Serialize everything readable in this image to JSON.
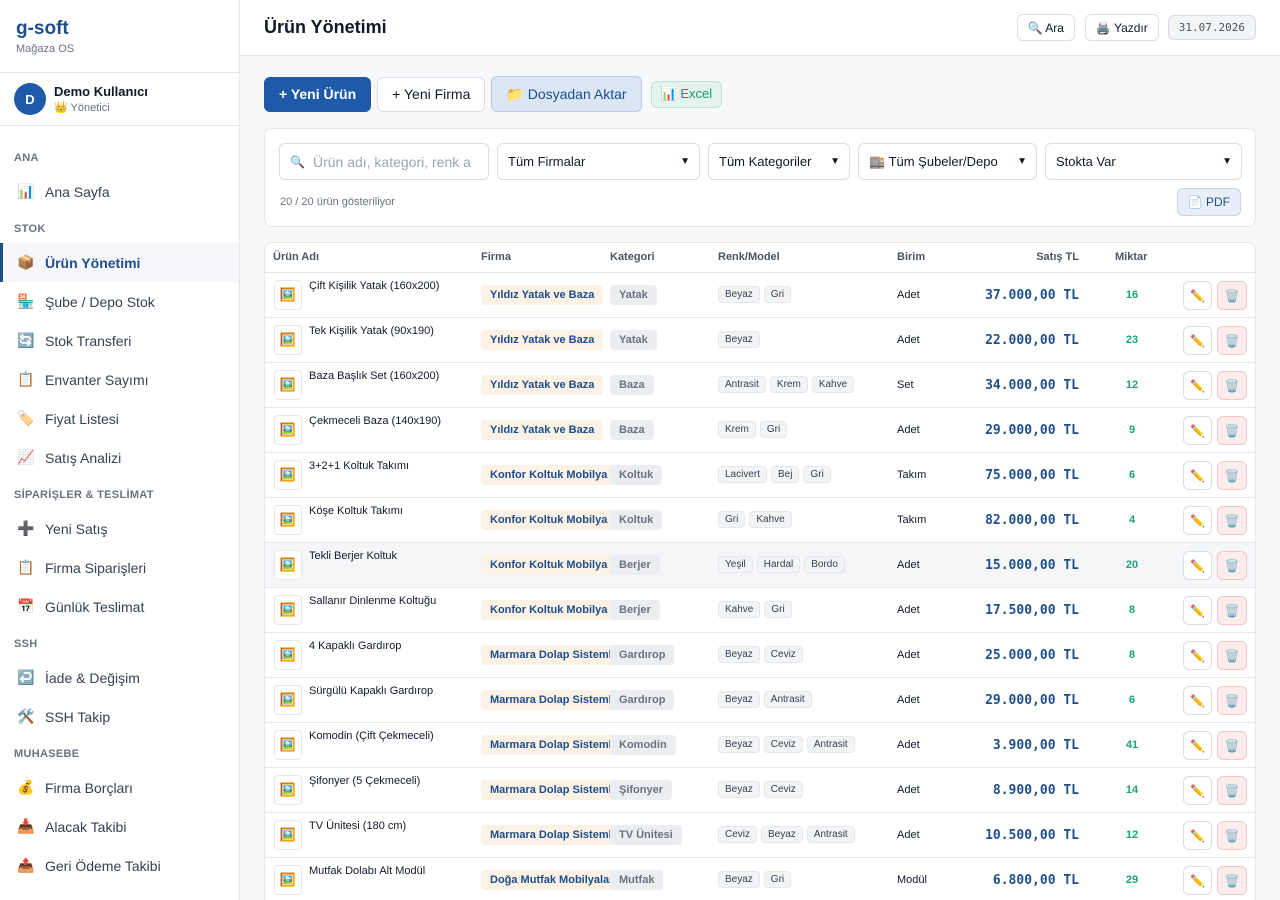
{
  "brand": {
    "name": "g-soft",
    "subtitle": "Mağaza OS"
  },
  "user": {
    "initial": "D",
    "name": "Demo Kullanıcı",
    "role": "👑 Yönetici"
  },
  "nav": [
    {
      "section": "ANA",
      "items": [
        {
          "icon": "📊",
          "label": "Ana Sayfa"
        }
      ]
    },
    {
      "section": "STOK",
      "items": [
        {
          "icon": "📦",
          "label": "Ürün Yönetimi",
          "active": true
        },
        {
          "icon": "🏪",
          "label": "Şube / Depo Stok"
        },
        {
          "icon": "🔄",
          "label": "Stok Transferi"
        },
        {
          "icon": "📋",
          "label": "Envanter Sayımı"
        },
        {
          "icon": "🏷️",
          "label": "Fiyat Listesi"
        },
        {
          "icon": "📈",
          "label": "Satış Analizi"
        }
      ]
    },
    {
      "section": "SİPARİŞLER & TESLİMAT",
      "items": [
        {
          "icon": "➕",
          "label": "Yeni Satış"
        },
        {
          "icon": "📋",
          "label": "Firma Siparişleri"
        },
        {
          "icon": "📅",
          "label": "Günlük Teslimat"
        }
      ]
    },
    {
      "section": "SSH",
      "items": [
        {
          "icon": "↩️",
          "label": "İade & Değişim"
        },
        {
          "icon": "🛠️",
          "label": "SSH Takip"
        }
      ]
    },
    {
      "section": "MUHASEBE",
      "items": [
        {
          "icon": "💰",
          "label": "Firma Borçları"
        },
        {
          "icon": "📥",
          "label": "Alacak Takibi"
        },
        {
          "icon": "📤",
          "label": "Geri Ödeme Takibi"
        }
      ]
    }
  ],
  "header": {
    "title": "Ürün Yönetimi",
    "search_label": "🔍 Ara",
    "print_label": "🖨️ Yazdır",
    "date": "31.07.2026"
  },
  "actions": {
    "new_product": "+ Yeni Ürün",
    "new_firm": "+ Yeni Firma",
    "import": "📁 Dosyadan Aktar",
    "excel": "📊 Excel"
  },
  "filters": {
    "search_placeholder": "Ürün adı, kategori, renk a",
    "firm": "Tüm Firmalar",
    "category": "Tüm Kategoriler",
    "branch": "🏬 Tüm Şubeler/Depo",
    "stock": "Stokta Var",
    "count_text": "20 / 20 ürün gösteriliyor",
    "pdf_label": "📄 PDF"
  },
  "table": {
    "columns": {
      "name": "Ürün Adı",
      "firm": "Firma",
      "category": "Kategori",
      "color": "Renk/Model",
      "unit": "Birim",
      "price": "Satış TL",
      "qty": "Miktar"
    },
    "rows": [
      {
        "name": "Çift Kişilik Yatak (160x200)",
        "firm": "Yıldız Yatak ve Baza",
        "category": "Yatak",
        "colors": [
          "Beyaz",
          "Gri"
        ],
        "unit": "Adet",
        "price": "37.000,00 TL",
        "qty": "16"
      },
      {
        "name": "Tek Kişilik Yatak (90x190)",
        "firm": "Yıldız Yatak ve Baza",
        "category": "Yatak",
        "colors": [
          "Beyaz"
        ],
        "unit": "Adet",
        "price": "22.000,00 TL",
        "qty": "23"
      },
      {
        "name": "Baza Başlık Set (160x200)",
        "firm": "Yıldız Yatak ve Baza",
        "category": "Baza",
        "colors": [
          "Antrasit",
          "Krem",
          "Kahve"
        ],
        "unit": "Set",
        "price": "34.000,00 TL",
        "qty": "12"
      },
      {
        "name": "Çekmeceli Baza (140x190)",
        "firm": "Yıldız Yatak ve Baza",
        "category": "Baza",
        "colors": [
          "Krem",
          "Gri"
        ],
        "unit": "Adet",
        "price": "29.000,00 TL",
        "qty": "9"
      },
      {
        "name": "3+2+1 Koltuk Takımı",
        "firm": "Konfor Koltuk Mobilya",
        "category": "Koltuk",
        "colors": [
          "Lacivert",
          "Bej",
          "Gri"
        ],
        "unit": "Takım",
        "price": "75.000,00 TL",
        "qty": "6"
      },
      {
        "name": "Köşe Koltuk Takımı",
        "firm": "Konfor Koltuk Mobilya",
        "category": "Koltuk",
        "colors": [
          "Gri",
          "Kahve"
        ],
        "unit": "Takım",
        "price": "82.000,00 TL",
        "qty": "4"
      },
      {
        "name": "Tekli Berjer Koltuk",
        "firm": "Konfor Koltuk Mobilya",
        "category": "Berjer",
        "colors": [
          "Yeşil",
          "Hardal",
          "Bordo"
        ],
        "unit": "Adet",
        "price": "15.000,00 TL",
        "qty": "20",
        "highlight": true
      },
      {
        "name": "Sallanır Dinlenme Koltuğu",
        "firm": "Konfor Koltuk Mobilya",
        "category": "Berjer",
        "colors": [
          "Kahve",
          "Gri"
        ],
        "unit": "Adet",
        "price": "17.500,00 TL",
        "qty": "8"
      },
      {
        "name": "4 Kapaklı Gardırop",
        "firm": "Marmara Dolap Sistemleri",
        "category": "Gardırop",
        "colors": [
          "Beyaz",
          "Ceviz"
        ],
        "unit": "Adet",
        "price": "25.000,00 TL",
        "qty": "8"
      },
      {
        "name": "Sürgülü Kapaklı Gardırop",
        "firm": "Marmara Dolap Sistemleri",
        "category": "Gardırop",
        "colors": [
          "Beyaz",
          "Antrasit"
        ],
        "unit": "Adet",
        "price": "29.000,00 TL",
        "qty": "6"
      },
      {
        "name": "Komodin (Çift Çekmeceli)",
        "firm": "Marmara Dolap Sistemleri",
        "category": "Komodin",
        "colors": [
          "Beyaz",
          "Ceviz",
          "Antrasit"
        ],
        "unit": "Adet",
        "price": "3.900,00 TL",
        "qty": "41"
      },
      {
        "name": "Şifonyer (5 Çekmeceli)",
        "firm": "Marmara Dolap Sistemleri",
        "category": "Şifonyer",
        "colors": [
          "Beyaz",
          "Ceviz"
        ],
        "unit": "Adet",
        "price": "8.900,00 TL",
        "qty": "14"
      },
      {
        "name": "TV Ünitesi (180 cm)",
        "firm": "Marmara Dolap Sistemleri",
        "category": "TV Ünitesi",
        "colors": [
          "Ceviz",
          "Beyaz",
          "Antrasit"
        ],
        "unit": "Adet",
        "price": "10.500,00 TL",
        "qty": "12"
      },
      {
        "name": "Mutfak Dolabı Alt Modül",
        "firm": "Doğa Mutfak Mobilyaları",
        "category": "Mutfak",
        "colors": [
          "Beyaz",
          "Gri"
        ],
        "unit": "Modül",
        "price": "6.800,00 TL",
        "qty": "29"
      }
    ]
  },
  "icons": {
    "thumb": "🖼️",
    "edit": "✏️",
    "delete": "🗑️"
  },
  "colors": {
    "brand": "#1e4e8c",
    "primary": "#1e5aa8",
    "qty": "#17a37a"
  }
}
